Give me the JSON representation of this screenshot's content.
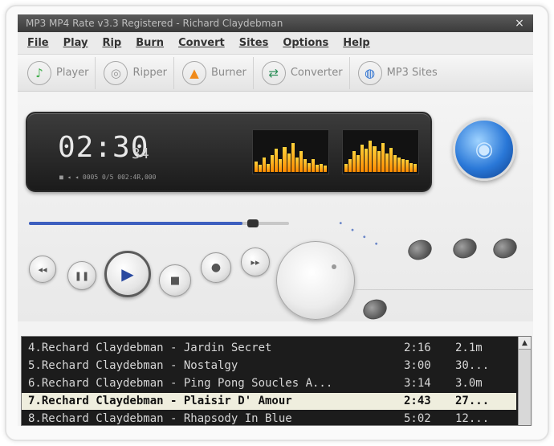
{
  "window": {
    "title": "MP3 MP4 Rate v3.3 Registered - Richard Claydebman",
    "close_glyph": "×"
  },
  "menu": [
    "File",
    "Play",
    "Rip",
    "Burn",
    "Convert",
    "Sites",
    "Options",
    "Help"
  ],
  "toolbar": [
    {
      "label": "Player",
      "icon": "player-icon",
      "glyph": "♪",
      "color": "#3fae4a"
    },
    {
      "label": "Ripper",
      "icon": "ripper-icon",
      "glyph": "◎",
      "color": "#9a9a9a"
    },
    {
      "label": "Burner",
      "icon": "burner-icon",
      "glyph": "▲",
      "color": "#f08a1a"
    },
    {
      "label": "Converter",
      "icon": "converter-icon",
      "glyph": "⇄",
      "color": "#2f8f5a"
    },
    {
      "label": "MP3 Sites",
      "icon": "globe-icon",
      "glyph": "◍",
      "color": "#2a6fd0"
    }
  ],
  "display": {
    "time": "02:30",
    "seconds_fraction": "34",
    "status_line": "■ ◂ ◂ 0005 0/5 002:4R,000"
  },
  "spectrum_left": [
    0.25,
    0.18,
    0.35,
    0.2,
    0.4,
    0.55,
    0.3,
    0.6,
    0.45,
    0.7,
    0.35,
    0.5,
    0.3,
    0.22,
    0.3,
    0.18,
    0.2,
    0.15
  ],
  "spectrum_right": [
    0.2,
    0.3,
    0.5,
    0.4,
    0.65,
    0.55,
    0.75,
    0.62,
    0.5,
    0.7,
    0.45,
    0.58,
    0.4,
    0.35,
    0.3,
    0.28,
    0.22,
    0.2
  ],
  "seek_progress": 0.82,
  "playlist": [
    {
      "title": "4.Rechard Claydebman - Jardin Secret",
      "time": "2:16",
      "size": "2.1m",
      "selected": false
    },
    {
      "title": "5.Rechard Claydebman - Nostalgy",
      "time": "3:00",
      "size": "30...",
      "selected": false
    },
    {
      "title": "6.Rechard Claydebman - Ping Pong Soucles A...",
      "time": "3:14",
      "size": "3.0m",
      "selected": false
    },
    {
      "title": "7.Rechard Claydebman - Plaisir D' Amour",
      "time": "2:43",
      "size": "27...",
      "selected": true
    },
    {
      "title": "8.Rechard Claydebman - Rhapsody In Blue",
      "time": "5:02",
      "size": "12...",
      "selected": false
    }
  ],
  "colors": {
    "accent": "#3d5fbf",
    "cd_blue": "#2a78d8",
    "playlist_bg": "#1c1c1c",
    "selected_row": "#efeede"
  }
}
